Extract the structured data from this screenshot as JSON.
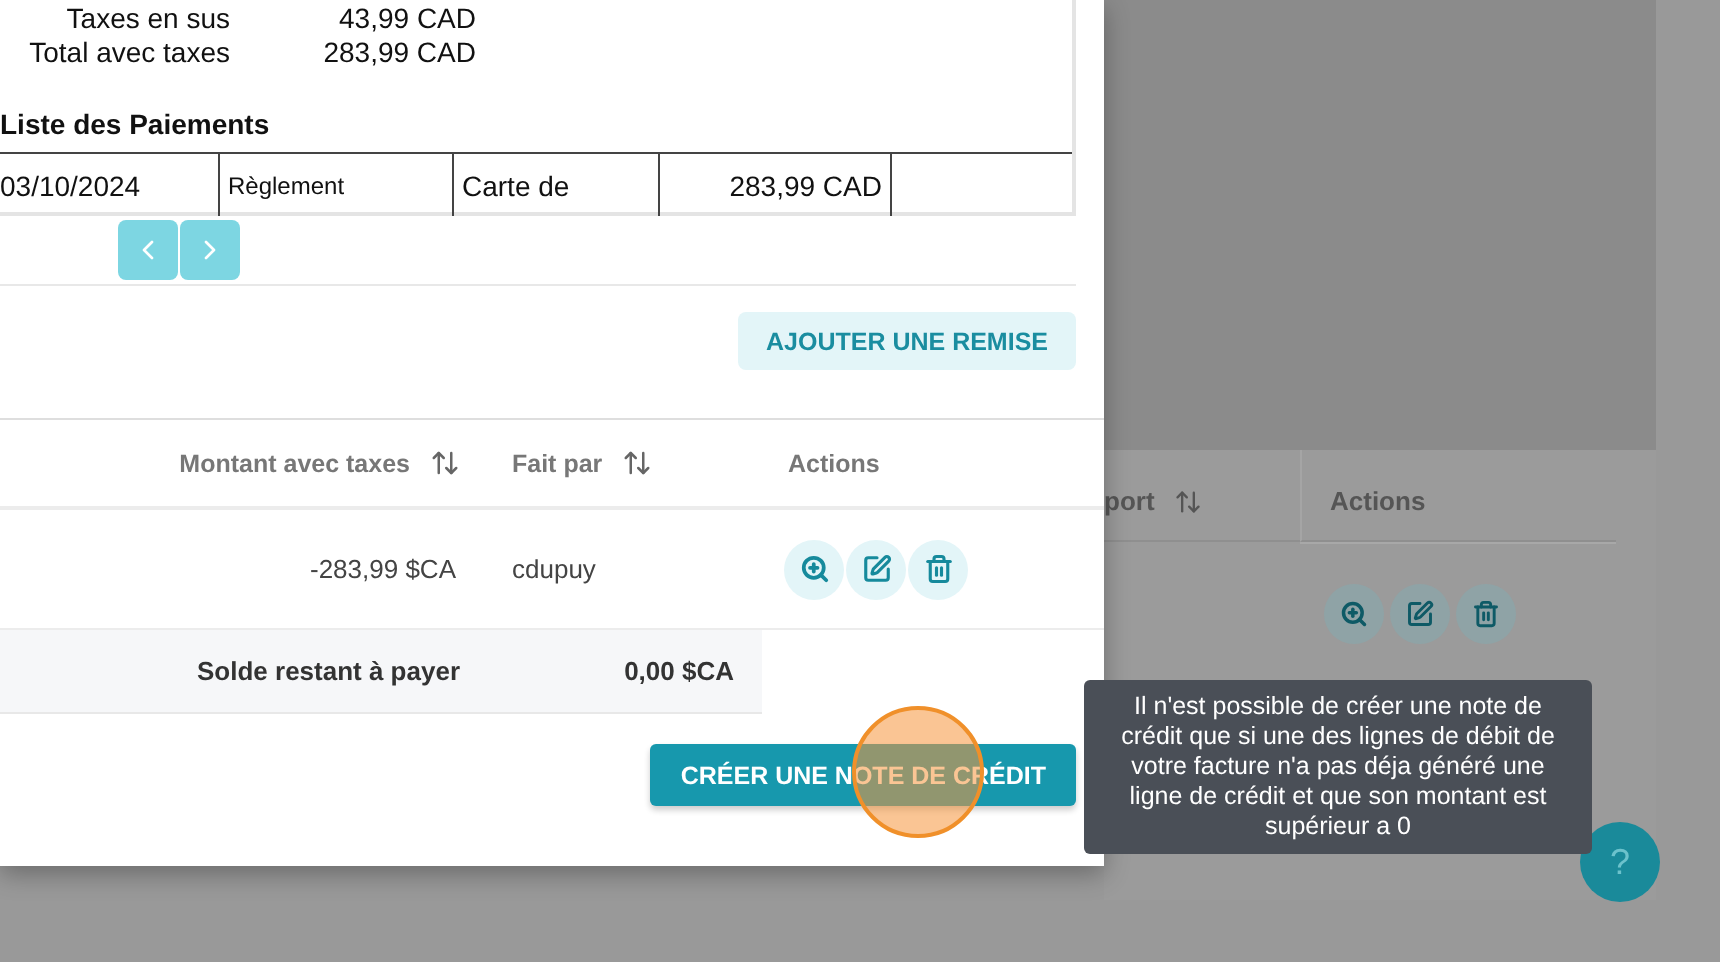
{
  "invoice_summary": [
    {
      "label": "Taxes en sus",
      "value": "43,99 CAD"
    },
    {
      "label": "Total avec taxes",
      "value": "283,99 CAD"
    }
  ],
  "payments": {
    "title": "Liste des Paiements",
    "rows": [
      [
        "03/10/2024",
        "Règlement",
        "Carte de",
        "283,99 CAD"
      ]
    ]
  },
  "discount_button": "AJOUTER UNE REMISE",
  "lines_table": {
    "columns": [
      {
        "label": "Montant avec taxes",
        "sortable": true
      },
      {
        "label": "Fait par",
        "sortable": true
      },
      {
        "label": "Actions",
        "sortable": false
      }
    ],
    "rows": [
      {
        "amount": "-283,99 $CA",
        "by": "cdupuy"
      }
    ],
    "balance": {
      "label": "Solde restant à payer",
      "value": "0,00 $CA"
    }
  },
  "credit_button": "CRÉER UNE NOTE DE CRÉDIT",
  "tooltip": "Il n'est possible de créer une note de crédit que si une des lignes de débit de votre facture n'a pas déja généré une ligne de crédit et que son montant est supérieur a 0",
  "background_table": {
    "columns": [
      {
        "label": "port",
        "sortable": true
      },
      {
        "label": "Actions",
        "sortable": false
      }
    ]
  },
  "help_button": "?"
}
